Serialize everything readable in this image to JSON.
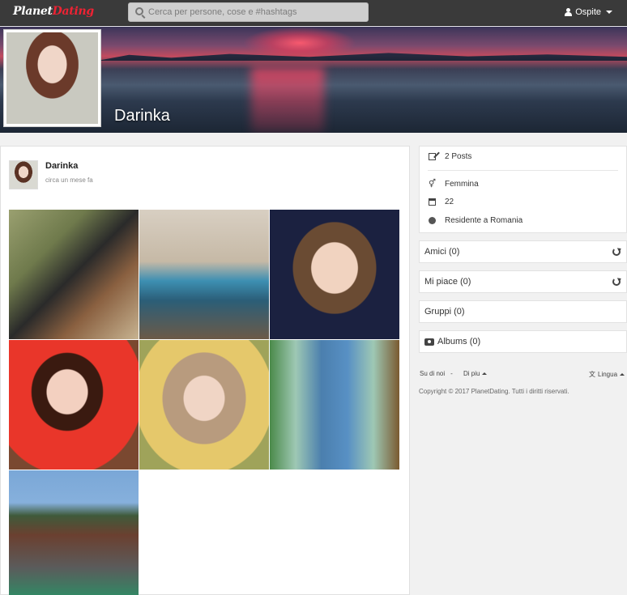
{
  "header": {
    "logo_part1": "Planet",
    "logo_part2": "Dating",
    "search_placeholder": "Cerca per persone, cose e #hashtags",
    "user_menu_label": "Ospite"
  },
  "profile": {
    "name": "Darinka"
  },
  "post": {
    "author": "Darinka",
    "time": "circa un mese fa",
    "photos": [
      "photo-1",
      "photo-2",
      "photo-3",
      "photo-4",
      "photo-5",
      "photo-6",
      "photo-7"
    ]
  },
  "sidebar": {
    "posts": "2 Posts",
    "gender": "Femmina",
    "age": "22",
    "location": "Residente a Romania",
    "friends": "Amici (0)",
    "likes": "Mi piace (0)",
    "groups": "Gruppi (0)",
    "albums": "Albums (0)"
  },
  "footer": {
    "about": "Su di noi",
    "separator": "-",
    "more": "Di piu",
    "language": "Lingua",
    "copyright": "Copyright © 2017 PlanetDating. Tutti i diritti riservati."
  },
  "icons": {
    "search": "search-icon",
    "user": "user-icon",
    "posts": "pencil-icon",
    "gender": "gender-icon",
    "age": "calendar-icon",
    "location": "globe-icon",
    "refresh": "refresh-icon",
    "albums": "camera-icon",
    "language": "language-icon"
  }
}
